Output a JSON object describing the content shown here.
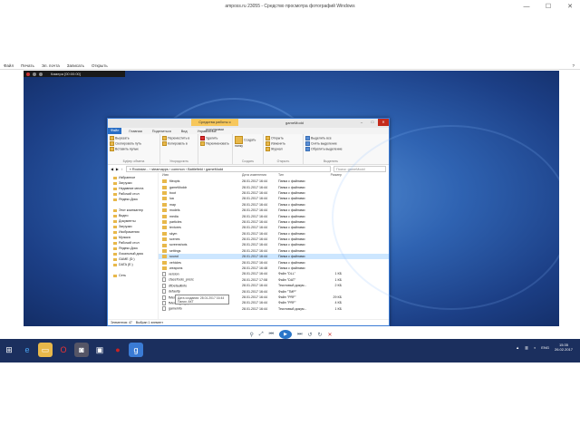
{
  "viewer": {
    "title": "amposs.ru 23055 - Средство просмотра фотографий Windows",
    "menu": [
      "Файл",
      "Печать",
      "Эл. почта",
      "Записать",
      "Открыть"
    ],
    "help_icon": "help-icon"
  },
  "recorder": {
    "label": "Камера [00:00:00]"
  },
  "explorer": {
    "context_tab": "Средства работы с рисунками",
    "window_name": "gameModd",
    "tabs": [
      "Файл",
      "Главная",
      "Поделиться",
      "Вид",
      "Управление"
    ],
    "ribbon": {
      "clipboard": [
        "Вырезать",
        "Скопировать путь",
        "Вставить ярлык"
      ],
      "clipboard_label": "Буфер обмена",
      "organize": [
        "Переместить в",
        "Копировать в"
      ],
      "organize2": [
        "Удалить",
        "Переименовать"
      ],
      "organize_label": "Упорядочить",
      "new_label": "Создать",
      "new_folder": "Создать папку",
      "open": [
        "Открыть",
        "Изменить",
        "Журнал"
      ],
      "open_label": "Открыть",
      "select": [
        "Выделить все",
        "Снять выделение",
        "Обратить выделение"
      ],
      "select_label": "Выделить"
    },
    "address": "« Rockstar... › steamapps › common › Battlefield › gameModd",
    "search_placeholder": "Поиск: gameModd",
    "columns": [
      "Имя",
      "Дата изменения",
      "Тип",
      "Размер"
    ],
    "nav": [
      {
        "label": "Избранное"
      },
      {
        "label": "Загрузки"
      },
      {
        "label": "Недавние места"
      },
      {
        "label": "Рабочий стол"
      },
      {
        "label": "Яндекс.Диск"
      },
      {
        "label": ""
      },
      {
        "label": "Этот компьютер"
      },
      {
        "label": "Видео"
      },
      {
        "label": "Документы"
      },
      {
        "label": "Загрузки"
      },
      {
        "label": "Изображения"
      },
      {
        "label": "Музыка"
      },
      {
        "label": "Рабочий стол"
      },
      {
        "label": "Яндекс.Диск"
      },
      {
        "label": "Локальный диск"
      },
      {
        "label": "GAME (D:)"
      },
      {
        "label": "DATA (E:)"
      },
      {
        "label": ""
      },
      {
        "label": "Сеть"
      }
    ],
    "rows": [
      {
        "name": "fileopts",
        "date": "28.01.2017 16:44",
        "type": "Папка с файлами",
        "size": ""
      },
      {
        "name": "gameModdr",
        "date": "28.01.2017 16:44",
        "type": "Папка с файлами",
        "size": ""
      },
      {
        "name": "boot",
        "date": "28.01.2017 16:44",
        "type": "Папка с файлами",
        "size": ""
      },
      {
        "name": "lua",
        "date": "28.01.2017 16:44",
        "type": "Папка с файлами",
        "size": ""
      },
      {
        "name": "map",
        "date": "28.01.2017 16:44",
        "type": "Папка с файлами",
        "size": ""
      },
      {
        "name": "models",
        "date": "28.01.2017 16:44",
        "type": "Папка с файлами",
        "size": ""
      },
      {
        "name": "media",
        "date": "28.01.2017 16:44",
        "type": "Папка с файлами",
        "size": ""
      },
      {
        "name": "particles",
        "date": "28.01.2017 16:44",
        "type": "Папка с файлами",
        "size": ""
      },
      {
        "name": "textures",
        "date": "28.01.2017 16:44",
        "type": "Папка с файлами",
        "size": ""
      },
      {
        "name": "skym",
        "date": "28.01.2017 16:44",
        "type": "Папка с файлами",
        "size": ""
      },
      {
        "name": "scenes",
        "date": "28.01.2017 16:44",
        "type": "Папка с файлами",
        "size": ""
      },
      {
        "name": "screenshots",
        "date": "28.01.2017 16:44",
        "type": "Папка с файлами",
        "size": ""
      },
      {
        "name": "settings",
        "date": "28.01.2017 16:44",
        "type": "Папка с файлами",
        "size": ""
      },
      {
        "name": "sound",
        "date": "28.01.2017 16:44",
        "type": "Папка с файлами",
        "size": ""
      },
      {
        "name": "vehicles",
        "date": "28.01.2017 16:44",
        "type": "Папка с файлами",
        "size": ""
      },
      {
        "name": "weapons",
        "date": "28.01.2017 16:48",
        "type": "Папка с файлами",
        "size": ""
      },
      {
        "name": "version",
        "date": "28.01.2017 16:44",
        "type": "Файл \"DLL\"",
        "size": "1 КБ"
      },
      {
        "name": "cfaceTools_pnsrc",
        "date": "28.01.2017 17:08",
        "type": "Файл \"DAT\"",
        "size": "1 КБ"
      },
      {
        "name": "dfDefaultinfo",
        "date": "28.01.2017 16:44",
        "type": "Текстовый докум...",
        "size": "2 КБ"
      },
      {
        "name": "defaultp",
        "date": "28.01.2017 16:44",
        "type": "Файл \"TMP\"",
        "size": ""
      },
      {
        "name": "fMenus_BB_upk",
        "date": "28.01.2017 16:44",
        "type": "Файл \"PRF\"",
        "size": "29 КБ"
      },
      {
        "name": "fMenus_lst_upk",
        "date": "28.01.2017 16:44",
        "type": "Файл \"PRF\"",
        "size": "4 КБ"
      },
      {
        "name": "gameinfo",
        "date": "28.01.2017 16:44",
        "type": "Текстовый докум...",
        "size": "1 КБ"
      }
    ],
    "selected_row": 13,
    "tooltip": "Дата создания: 28.01.2017 16:44\nПапки: АКТ",
    "status_items": "Элементов: 47",
    "status_selected": "Выбран 1 элемент"
  },
  "player": {
    "buttons": [
      "zoom",
      "prev",
      "play",
      "next",
      "rotate-left",
      "rotate-right",
      "delete"
    ]
  },
  "taskbar": {
    "apps": [
      "ie",
      "explorer",
      "opera",
      "camera",
      "record",
      "steam",
      "g"
    ],
    "tray_lang": "ENG",
    "time": "15:35",
    "date": "26.02.2017"
  }
}
